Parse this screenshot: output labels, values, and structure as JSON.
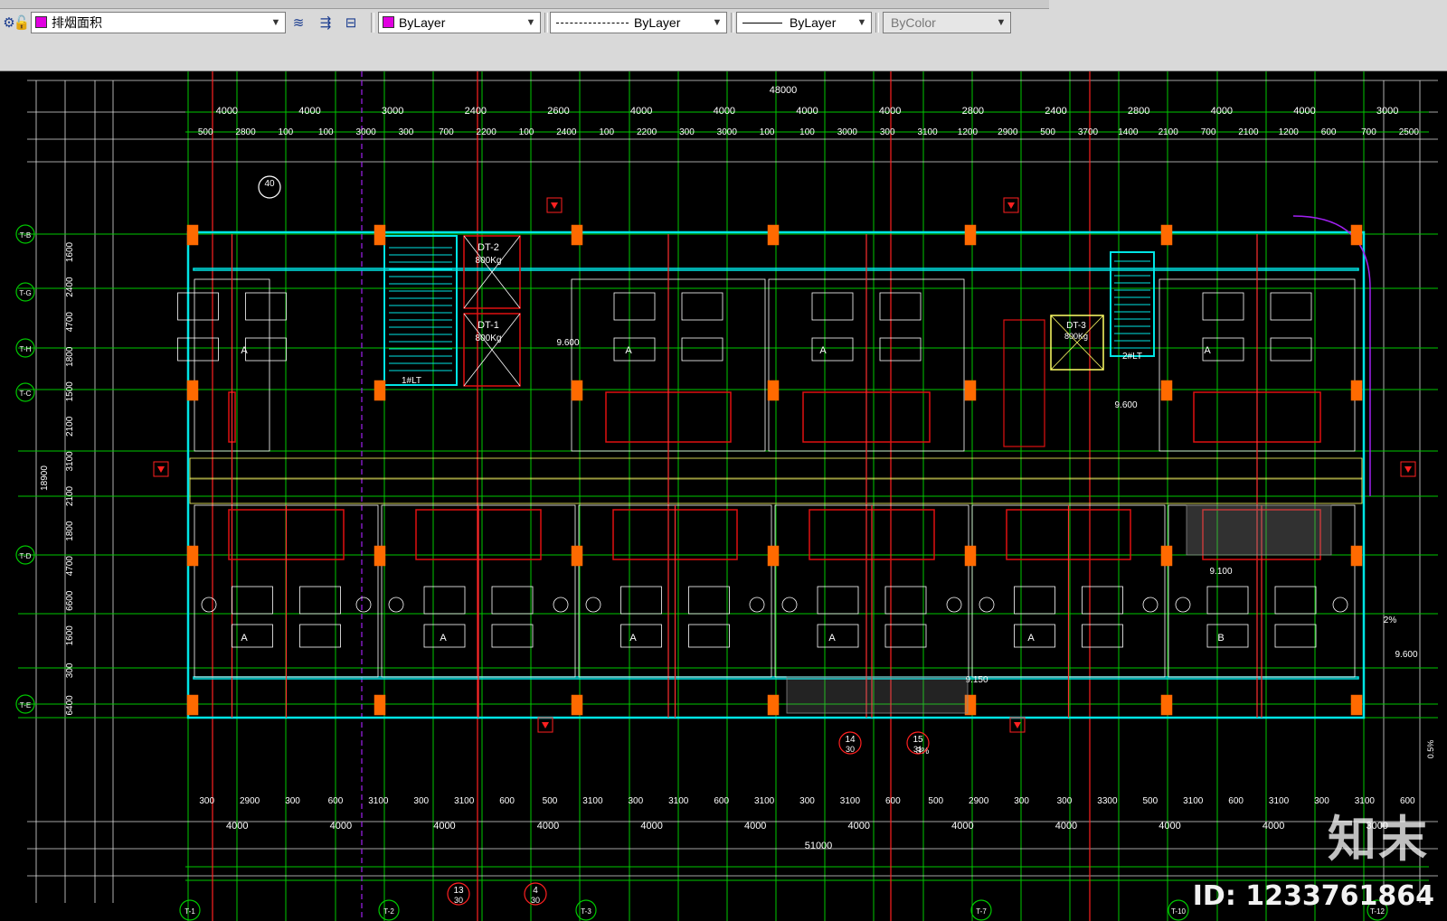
{
  "toolbar": {
    "layer": {
      "name": "排烟面积",
      "swatch_color": "#e000e0"
    },
    "color": {
      "value": "ByLayer",
      "swatch_color": "#e000e0"
    },
    "linetype": {
      "value": "ByLayer"
    },
    "lineweight": {
      "value": "ByLayer"
    },
    "plotstyle": {
      "value": "ByColor"
    },
    "icons": [
      "layer-state-icon",
      "layer-previous-icon",
      "make-current-icon",
      "match-layer-icon"
    ]
  },
  "drawing": {
    "colors": {
      "grid": "#00c800",
      "wall": "#00e5e5",
      "room": "#e01010",
      "column": "#ff6a00",
      "text": "#ffff66",
      "dim": "#ffffff"
    },
    "total_dims": [
      "48000",
      "51000",
      "18900"
    ],
    "top_dims": [
      "4000",
      "4000",
      "3000",
      "2400",
      "2600",
      "4000",
      "4000",
      "4000",
      "4000",
      "2800",
      "2400",
      "2800",
      "4000",
      "4000",
      "3000"
    ],
    "top_subdims": [
      "500",
      "2800",
      "100",
      "100",
      "3000",
      "300",
      "700",
      "2200",
      "100",
      "2400",
      "100",
      "2200",
      "300",
      "3000",
      "100",
      "100",
      "3000",
      "300",
      "3100",
      "1200",
      "2900",
      "500",
      "3700",
      "1400",
      "2100",
      "700",
      "2100",
      "1200",
      "600",
      "700",
      "2500"
    ],
    "bottom_subdims": [
      "300",
      "2900",
      "300",
      "600",
      "3100",
      "300",
      "3100",
      "600",
      "500",
      "3100",
      "300",
      "3100",
      "600",
      "3100",
      "300",
      "3100",
      "600",
      "500",
      "2900",
      "300",
      "300",
      "3300",
      "500",
      "3100",
      "600",
      "3100",
      "300",
      "3100",
      "600"
    ],
    "bottom_dims": [
      "4000",
      "4000",
      "4000",
      "4000",
      "4000",
      "4000",
      "4000",
      "4000",
      "4000",
      "4000",
      "4000",
      "3000"
    ],
    "left_dims": [
      "1600",
      "2400",
      "4700",
      "1800",
      "1500",
      "2100",
      "3100",
      "2100",
      "1800",
      "4700",
      "6600",
      "1600",
      "300",
      "6400"
    ],
    "axis_labels_left": [
      "T-B",
      "T-G",
      "T-H",
      "T-C",
      "T-D",
      "T-E"
    ],
    "axis_labels_bottom": [
      "T-1",
      "T-2",
      "T-3",
      "T-7",
      "T-10",
      "T-12"
    ],
    "elevator_tags": [
      "DT-2",
      "DT-1",
      "DT-3"
    ],
    "elevator_loads": [
      "800Kg",
      "800Kg",
      "800Kg"
    ],
    "stair_tags": [
      "1#LT",
      "2#LT"
    ],
    "detail_callouts": [
      "40",
      "14",
      "15",
      "13",
      "4"
    ],
    "callout_sheets": [
      "30",
      "31",
      "30",
      "30"
    ],
    "room_marks": [
      "A",
      "A",
      "A",
      "A",
      "A",
      "A",
      "A",
      "A",
      "A",
      "B"
    ],
    "levels": [
      "9.600",
      "9.600",
      "9.100",
      "9.150",
      "9.600"
    ],
    "slope": [
      "2%",
      "0.5%",
      "3%"
    ]
  },
  "watermark": {
    "brand": "知末",
    "id": "ID: 1233761864"
  }
}
